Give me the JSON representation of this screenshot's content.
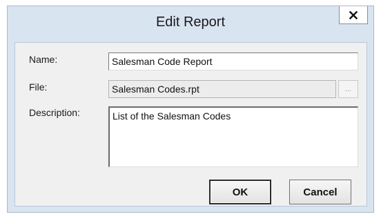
{
  "dialog": {
    "title": "Edit Report",
    "close_label": "x"
  },
  "form": {
    "name": {
      "label": "Name:",
      "value": "Salesman Code Report"
    },
    "file": {
      "label": "File:",
      "value": "Salesman Codes.rpt",
      "browse_label": "..."
    },
    "description": {
      "label": "Description:",
      "value": "List of the Salesman Codes"
    }
  },
  "buttons": {
    "ok_label": "OK",
    "cancel_label": "Cancel"
  },
  "colors": {
    "frame": "#d9e4f1",
    "client": "#f0f0f0",
    "readonly_field": "#ececec"
  },
  "icons": {
    "close": "close-icon"
  }
}
